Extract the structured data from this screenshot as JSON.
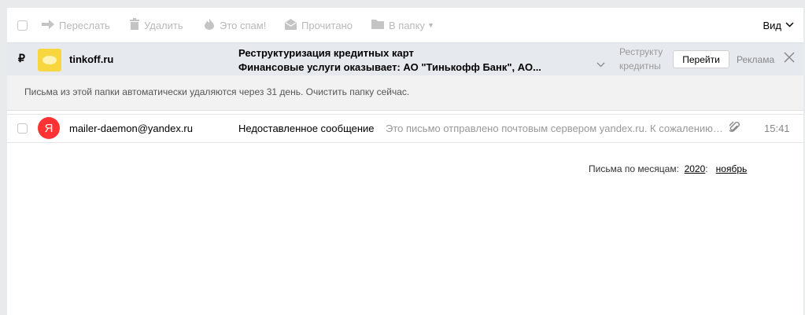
{
  "toolbar": {
    "forward": "Переслать",
    "delete": "Удалить",
    "spam": "Это спам!",
    "read": "Прочитано",
    "to_folder": "В папку",
    "view": "Вид"
  },
  "ad": {
    "currency_symbol": "₽",
    "sender": "tinkoff.ru",
    "title": "Реструктуризация кредитных карт",
    "subtitle": "Финансовые услуги оказывает: АО \"Тинькофф Банк\", АО...",
    "gray_line1": "Реструкту",
    "gray_line2": "кредитны",
    "go_button": "Перейти",
    "label": "Реклама"
  },
  "notice": {
    "text": "Письма из этой папки автоматически удаляются через 31 день.",
    "link": "Очистить папку сейчас."
  },
  "messages": [
    {
      "avatar_letter": "Я",
      "from": "mailer-daemon@yandex.ru",
      "subject": "Недоставленное сообщение",
      "snippet": "Это письмо отправлено почтовым сервером yandex.ru. К сожалению…",
      "time": "15:41",
      "has_attachment": true
    }
  ],
  "months": {
    "label": "Письма по месяцам:",
    "year": "2020",
    "year_suffix": ":",
    "month": "ноябрь"
  },
  "colors": {
    "avatar": "#ff3333",
    "logo": "#f7d640",
    "ad_background": "#e6e9ee"
  }
}
